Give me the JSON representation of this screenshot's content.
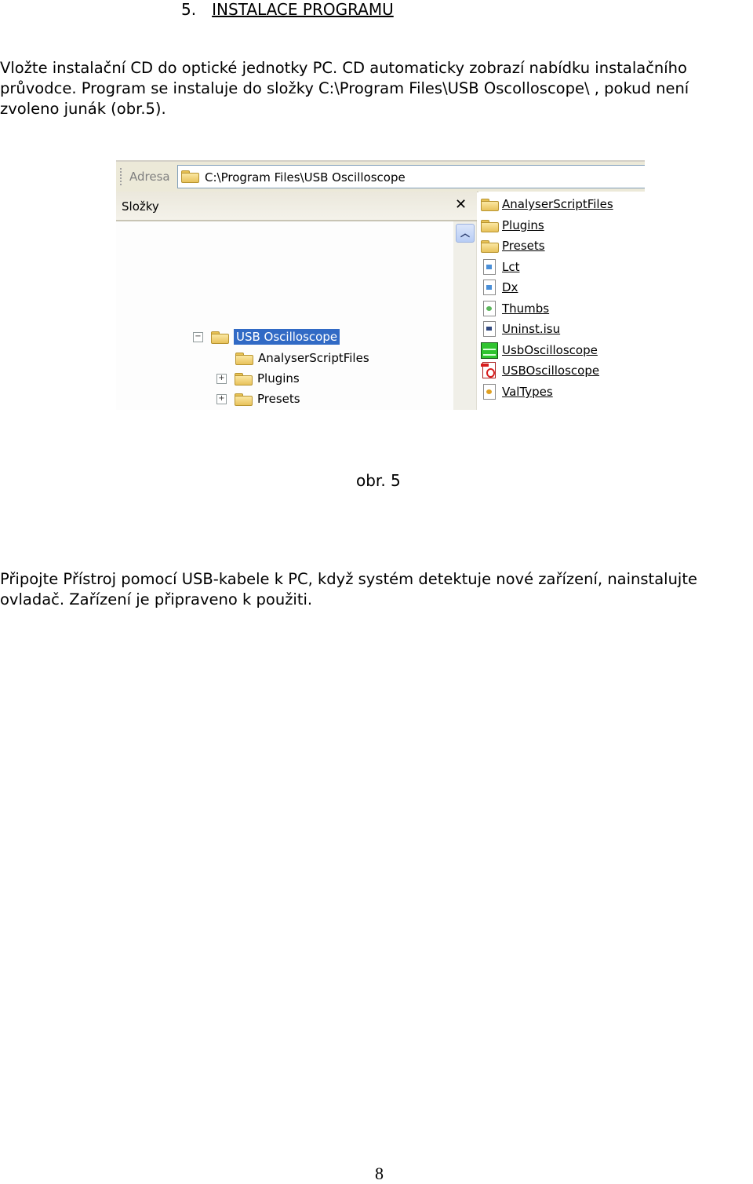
{
  "heading": {
    "number": "5.",
    "title": "INSTALACE PROGRAMU"
  },
  "paragraph1": [
    "Vložte instalační CD do optické jednotky PC.  CD automaticky zobrazí nabídku instalačního",
    "průvodce. Program se instaluje do složky C:\\Program Files\\USB Oscolloscope\\ , pokud není",
    "zvoleno junák (obr.5)."
  ],
  "figure": {
    "address_label": "Adresa",
    "address_value": "C:\\Program Files\\USB Oscilloscope",
    "folders_pane_title": "Složky",
    "close_icon": "close-icon",
    "scroll_up_icon": "chevron-up-icon",
    "tree": [
      {
        "label": "USB Oscilloscope",
        "expander": "−",
        "selected": true,
        "icon": "folder-open-icon"
      },
      {
        "label": "AnalyserScriptFiles",
        "expander": "",
        "selected": false,
        "icon": "folder-icon"
      },
      {
        "label": "Plugins",
        "expander": "+",
        "selected": false,
        "icon": "folder-icon"
      },
      {
        "label": "Presets",
        "expander": "+",
        "selected": false,
        "icon": "folder-icon"
      }
    ],
    "files": [
      {
        "name": "AnalyserScriptFiles",
        "icon": "folder-icon"
      },
      {
        "name": "Plugins",
        "icon": "folder-icon"
      },
      {
        "name": "Presets",
        "icon": "folder-icon"
      },
      {
        "name": "Lct",
        "icon": "file-icon"
      },
      {
        "name": "Dx",
        "icon": "file-icon"
      },
      {
        "name": "Thumbs",
        "icon": "thumbs-db-icon"
      },
      {
        "name": "Uninst.isu",
        "icon": "installer-file-icon"
      },
      {
        "name": "UsbOscilloscope",
        "icon": "oscilloscope-app-icon"
      },
      {
        "name": "USBOscilloscope",
        "icon": "pdf-icon"
      },
      {
        "name": "ValTypes",
        "icon": "config-file-icon"
      }
    ],
    "caption": "obr. 5"
  },
  "paragraph2": [
    "Připojte Přístroj pomocí USB-kabele k PC, když systém detektuje nové zařízení, nainstalujte",
    "ovladač. Zařízení je připraveno k použiti."
  ],
  "page_number": "8"
}
